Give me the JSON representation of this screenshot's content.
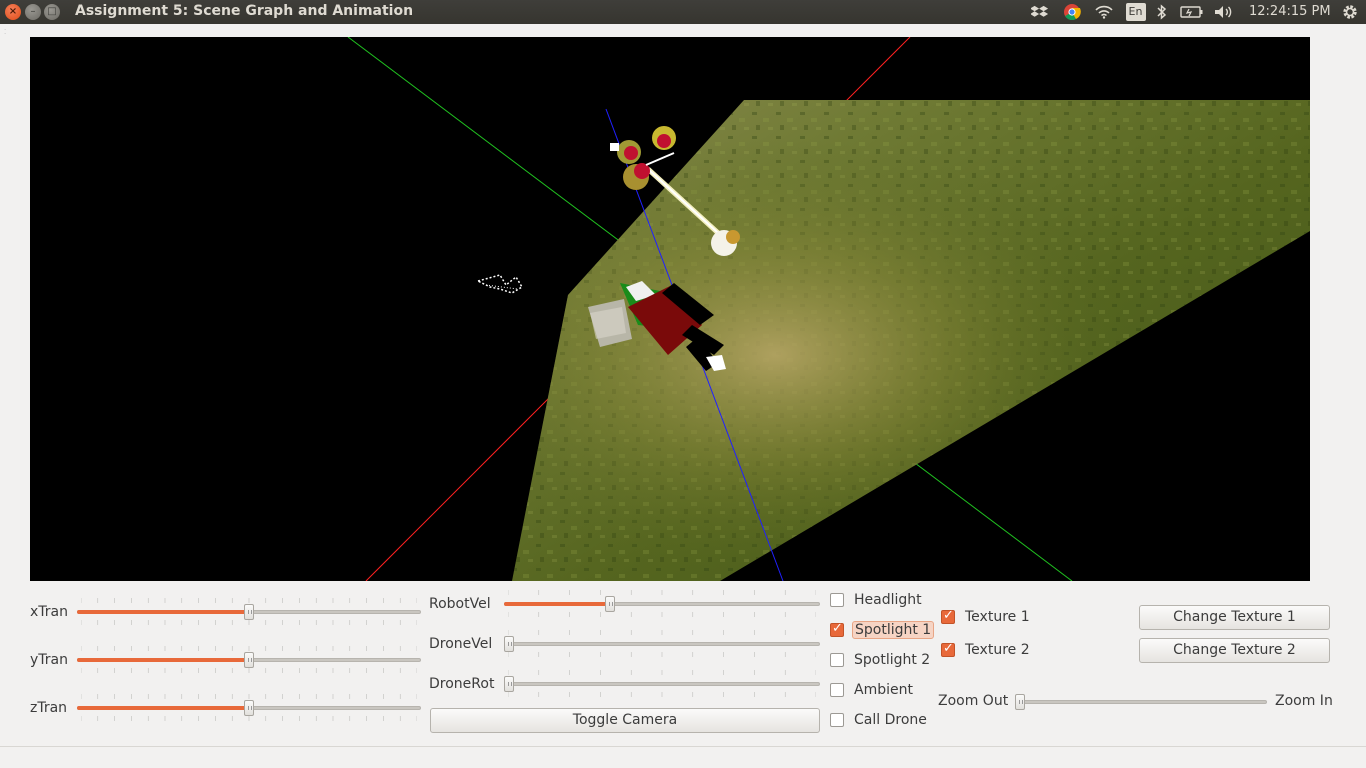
{
  "window": {
    "title": "Assignment 5: Scene Graph and Animation",
    "close_glyph": "×",
    "min_glyph": "–",
    "max_glyph": "□"
  },
  "tray": {
    "icons": [
      "dropbox-icon",
      "chrome-icon",
      "wifi-icon",
      "keyboard-layout-icon",
      "bluetooth-icon",
      "battery-icon",
      "volume-icon",
      "settings-gear-icon"
    ],
    "keyboard_layout": "En",
    "clock": "12:24:15 PM"
  },
  "controls": {
    "xtran": {
      "label": "xTran",
      "value": 0.5
    },
    "ytran": {
      "label": "yTran",
      "value": 0.5
    },
    "ztran": {
      "label": "zTran",
      "value": 0.5
    },
    "robotvel": {
      "label": "RobotVel",
      "value": 0.33
    },
    "dronevel": {
      "label": "DroneVel",
      "value": 0.0
    },
    "dronerot": {
      "label": "DroneRot",
      "value": 0.0
    },
    "toggle_camera": "Toggle Camera",
    "checkboxes": [
      {
        "label": "Headlight",
        "checked": false
      },
      {
        "label": "Spotlight 1",
        "checked": true
      },
      {
        "label": "Spotlight 2",
        "checked": false
      },
      {
        "label": "Ambient",
        "checked": false
      },
      {
        "label": "Call Drone",
        "checked": false
      }
    ],
    "textures": [
      {
        "label": "Texture 1",
        "checked": true
      },
      {
        "label": "Texture 2",
        "checked": true
      }
    ],
    "change_texture_1": "Change Texture 1",
    "change_texture_2": "Change Texture 2",
    "zoom": {
      "min_label": "Zoom Out",
      "max_label": "Zoom In",
      "value": 0.0
    }
  },
  "colors": {
    "accent": "#e8693a",
    "titlebar": "#3c3b37",
    "window_bg": "#f2f1f0",
    "axis_x": "#ff2020",
    "axis_y": "#20c020",
    "axis_z": "#2020ff"
  }
}
